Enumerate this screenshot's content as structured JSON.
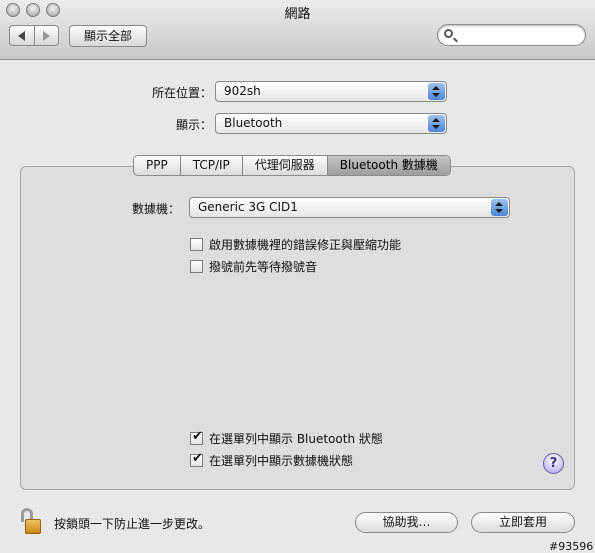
{
  "window": {
    "title": "網路"
  },
  "toolbar": {
    "back_icon": "back-arrow-icon",
    "forward_icon": "forward-arrow-icon",
    "show_all_label": "顯示全部",
    "search": {
      "value": "",
      "placeholder": ""
    }
  },
  "location": {
    "label": "所在位置：",
    "value": "902sh"
  },
  "show": {
    "label": "顯示：",
    "value": "Bluetooth"
  },
  "tabs": [
    {
      "label": "PPP"
    },
    {
      "label": "TCP/IP"
    },
    {
      "label": "代理伺服器"
    },
    {
      "label": "Bluetooth 數據機",
      "active": true
    }
  ],
  "modem": {
    "label": "數據機：",
    "value": "Generic 3G CID1"
  },
  "options": [
    {
      "label": "啟用數據機裡的錯誤修正與壓縮功能",
      "checked": false
    },
    {
      "label": "撥號前先等待撥號音",
      "checked": false
    }
  ],
  "menubar_options": [
    {
      "label": "在選單列中顯示 Bluetooth 狀態",
      "checked": true
    },
    {
      "label": "在選單列中顯示數據機狀態",
      "checked": true
    }
  ],
  "help_label": "?",
  "lock": {
    "text": "按鎖頭一下防止進一步更改。"
  },
  "buttons": {
    "assist": "協助我…",
    "apply": "立即套用"
  },
  "watermark": "#93596"
}
